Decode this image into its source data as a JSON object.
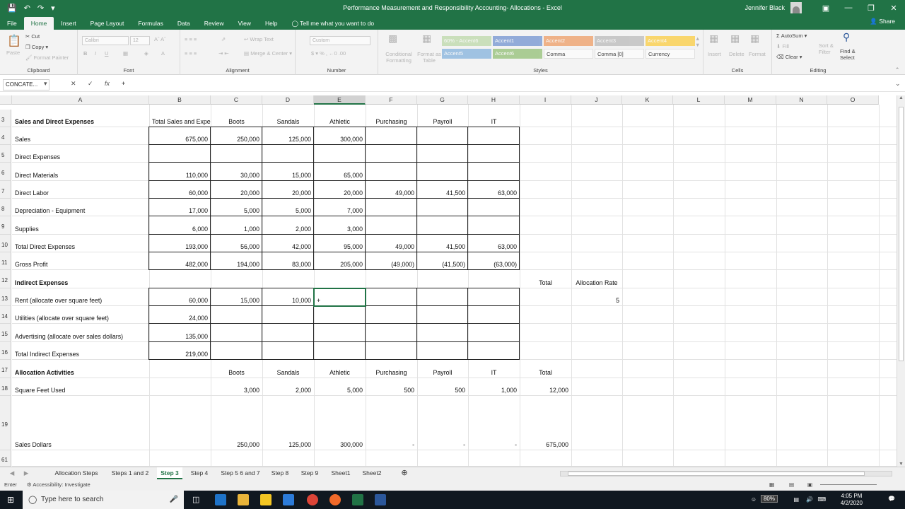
{
  "titlebar": {
    "title": "Performance Measurement and Responsibility Accounting- Allocations  -  Excel",
    "user": "Jennifer Black"
  },
  "ribbon_tabs": [
    "File",
    "Home",
    "Insert",
    "Page Layout",
    "Formulas",
    "Data",
    "Review",
    "View",
    "Help"
  ],
  "tell_me": "Tell me what you want to do",
  "share": "Share",
  "ribbon": {
    "clipboard": {
      "label": "Clipboard",
      "paste": "Paste",
      "cut": "Cut",
      "copy": "Copy",
      "format_painter": "Format Painter"
    },
    "font": {
      "label": "Font",
      "name": "Calibri",
      "size": "12"
    },
    "alignment": {
      "label": "Alignment",
      "wrap": "Wrap Text",
      "merge": "Merge & Center"
    },
    "number": {
      "label": "Number",
      "format": "Custom"
    },
    "styles": {
      "label": "Styles",
      "conditional": "Conditional Formatting",
      "format_as_table": "Format as Table",
      "cells": [
        {
          "name": "60% - Accent6",
          "color": "#a9d08e"
        },
        {
          "name": "Accent1",
          "color": "#4472c4"
        },
        {
          "name": "Accent2",
          "color": "#ed7d31"
        },
        {
          "name": "Accent3",
          "color": "#a5a5a5"
        },
        {
          "name": "Accent4",
          "color": "#ffc000"
        },
        {
          "name": "Accent5",
          "color": "#5b9bd5"
        },
        {
          "name": "Accent6",
          "color": "#70ad47"
        },
        {
          "name": "Comma",
          "color": ""
        },
        {
          "name": "Comma [0]",
          "color": ""
        },
        {
          "name": "Currency",
          "color": ""
        }
      ]
    },
    "cells": {
      "label": "Cells",
      "insert": "Insert",
      "delete": "Delete",
      "format": "Format"
    },
    "editing": {
      "label": "Editing",
      "autosum": "AutoSum",
      "fill": "Fill",
      "clear": "Clear",
      "sort_filter": "Sort & Filter",
      "find_select": "Find & Select"
    }
  },
  "formula_bar": {
    "name_box": "CONCATE...",
    "formula": "+"
  },
  "columns": [
    "A",
    "B",
    "C",
    "D",
    "E",
    "F",
    "G",
    "H",
    "I",
    "J",
    "K",
    "L",
    "M",
    "N",
    "O"
  ],
  "rows": [
    "3",
    "4",
    "5",
    "6",
    "7",
    "8",
    "9",
    "10",
    "11",
    "12",
    "13",
    "14",
    "15",
    "16",
    "17",
    "18",
    "19",
    "61"
  ],
  "sheet": {
    "r3": {
      "A": "Sales and Direct Expenses",
      "B": "Total Sales and Expe",
      "C": "Boots",
      "D": "Sandals",
      "E": "Athletic",
      "F": "Purchasing",
      "G": "Payroll",
      "H": "IT"
    },
    "r4": {
      "A": "Sales",
      "B": "675,000",
      "C": "250,000",
      "D": "125,000",
      "E": "300,000"
    },
    "r5": {
      "A": "Direct Expenses"
    },
    "r6": {
      "A": "Direct Materials",
      "B": "110,000",
      "C": "30,000",
      "D": "15,000",
      "E": "65,000"
    },
    "r7": {
      "A": "Direct Labor",
      "B": "60,000",
      "C": "20,000",
      "D": "20,000",
      "E": "20,000",
      "F": "49,000",
      "G": "41,500",
      "H": "63,000"
    },
    "r8": {
      "A": "Depreciation - Equipment",
      "B": "17,000",
      "C": "5,000",
      "D": "5,000",
      "E": "7,000"
    },
    "r9": {
      "A": "Supplies",
      "B": "6,000",
      "C": "1,000",
      "D": "2,000",
      "E": "3,000"
    },
    "r10": {
      "A": "Total Direct Expenses",
      "B": "193,000",
      "C": "56,000",
      "D": "42,000",
      "E": "95,000",
      "F": "49,000",
      "G": "41,500",
      "H": "63,000"
    },
    "r11": {
      "A": "Gross Profit",
      "B": "482,000",
      "C": "194,000",
      "D": "83,000",
      "E": "205,000",
      "F": "(49,000)",
      "G": "(41,500)",
      "H": "(63,000)"
    },
    "r12": {
      "A": "Indirect Expenses",
      "I": "Total",
      "J": "Allocation Rate"
    },
    "r13": {
      "A": "Rent (allocate over square feet)",
      "B": "60,000",
      "C": "15,000",
      "D": "10,000",
      "E": "+",
      "J": "5"
    },
    "r14": {
      "A": "Utilities (allocate over square feet)",
      "B": "24,000"
    },
    "r15": {
      "A": "Advertising (allocate over sales dollars)",
      "B": "135,000"
    },
    "r16": {
      "A": "Total Indirect Expenses",
      "B": "219,000"
    },
    "r17": {
      "A": "Allocation Activities",
      "C": "Boots",
      "D": "Sandals",
      "E": "Athletic",
      "F": "Purchasing",
      "G": "Payroll",
      "H": "IT",
      "I": "Total"
    },
    "r18": {
      "A": "Square Feet Used",
      "C": "3,000",
      "D": "2,000",
      "E": "5,000",
      "F": "500",
      "G": "500",
      "H": "1,000",
      "I": "12,000"
    },
    "r19": {
      "A": "Sales Dollars",
      "C": "250,000",
      "D": "125,000",
      "E": "300,000",
      "F": "-",
      "G": "-",
      "H": "-",
      "I": "675,000"
    }
  },
  "sheet_tabs": [
    "Allocation Steps",
    "Steps 1 and 2",
    "Step 3",
    "Step 4",
    "Step 5 6 and 7",
    "Step 8",
    "Step 9",
    "Sheet1",
    "Sheet2"
  ],
  "active_sheet": "Step 3",
  "status": {
    "mode": "Enter",
    "accessibility": "Accessibility: Investigate",
    "zoom": "80%"
  },
  "taskbar": {
    "search": "Type here to search",
    "time": "4:05 PM",
    "date": "4/2/2020",
    "battery": "80%"
  }
}
